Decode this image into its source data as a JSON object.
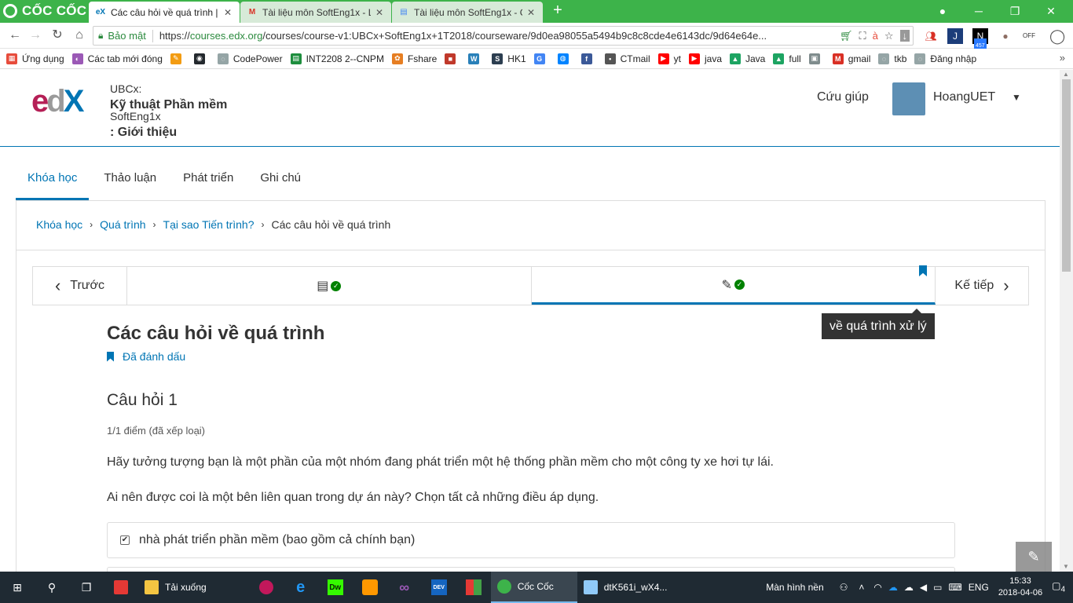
{
  "browser": {
    "brand": "CỐC CỐC",
    "tabs": [
      {
        "label": "Các câu hỏi về quá trình | ",
        "icon": "edx"
      },
      {
        "label": "Tài liệu môn SoftEng1x - L",
        "icon": "gmail"
      },
      {
        "label": "Tài liệu môn SoftEng1x - G",
        "icon": "docs"
      }
    ],
    "new_tab": "+",
    "secure_label": "Bảo mật",
    "url_scheme": "https://",
    "url_host": "courses.edx.org",
    "url_path": "/courses/course-v1:UBCx+SoftEng1x+1T2018/courseware/9d0ea98055a5494b9c8c8cde4e6143dc/9d64e64e...",
    "ext_badges": {
      "first": "1",
      "second": "457"
    }
  },
  "bookmarks": [
    {
      "label": "Ứng dụng",
      "color": "#e74c3c",
      "glyph": "▦"
    },
    {
      "label": "Các tab mới đóng",
      "color": "#9b59b6",
      "glyph": "◐"
    },
    {
      "label": "",
      "color": "#f39c12",
      "glyph": "✎"
    },
    {
      "label": "",
      "color": "#24292e",
      "glyph": "◉"
    },
    {
      "label": "CodePower",
      "color": "#95a5a6",
      "glyph": "◌"
    },
    {
      "label": "INT2208 2--CNPM",
      "color": "#1e8e3e",
      "glyph": "▤"
    },
    {
      "label": "Fshare",
      "color": "#e67e22",
      "glyph": "✿"
    },
    {
      "label": "",
      "color": "#c0392b",
      "glyph": "■"
    },
    {
      "label": "",
      "color": "#2980b9",
      "glyph": "W"
    },
    {
      "label": "HK1",
      "color": "#2c3e50",
      "glyph": "S"
    },
    {
      "label": "",
      "color": "#4285f4",
      "glyph": "G"
    },
    {
      "label": "",
      "color": "#0084ff",
      "glyph": "◍"
    },
    {
      "label": "",
      "color": "#3b5998",
      "glyph": "f"
    },
    {
      "label": "CTmail",
      "color": "#555555",
      "glyph": "•"
    },
    {
      "label": "yt",
      "color": "#ff0000",
      "glyph": "▶"
    },
    {
      "label": "java",
      "color": "#ff0000",
      "glyph": "▶"
    },
    {
      "label": "Java",
      "color": "#1da462",
      "glyph": "▲"
    },
    {
      "label": "full",
      "color": "#1da462",
      "glyph": "▲"
    },
    {
      "label": "",
      "color": "#7f8c8d",
      "glyph": "▣"
    },
    {
      "label": "gmail",
      "color": "#d93025",
      "glyph": "M"
    },
    {
      "label": "tkb",
      "color": "#95a5a6",
      "glyph": "◌"
    },
    {
      "label": "Đăng nhập",
      "color": "#95a5a6",
      "glyph": "◌"
    }
  ],
  "bookmarks_more": "»",
  "header": {
    "org": "UBCx:",
    "course_name": "Kỹ thuật Phần mềm",
    "course_code": "SoftEng1x",
    "course_sub": ": Giới thiệu",
    "help": "Cứu giúp",
    "username": "HoangUET",
    "user_caret": "▼"
  },
  "course_tabs": [
    {
      "label": "Khóa học",
      "active": true
    },
    {
      "label": "Thảo luận",
      "active": false
    },
    {
      "label": "Phát triển",
      "active": false
    },
    {
      "label": "Ghi chú",
      "active": false
    }
  ],
  "breadcrumb": {
    "items": [
      "Khóa học",
      "Quá trình",
      "Tại sao Tiến trình?"
    ],
    "current": "Các câu hỏi về quá trình",
    "separator": "›"
  },
  "sequence": {
    "prev": "Trước",
    "next": "Kế tiếp",
    "prev_icon": "‹",
    "next_icon": "›",
    "check_glyph": "✓",
    "video_icon": "▤",
    "problem_icon": "✎"
  },
  "tooltip": "về quá trình xử lý",
  "unit": {
    "title": "Các câu hỏi về quá trình",
    "bookmarked": "Đã đánh dấu"
  },
  "question": {
    "title": "Câu hỏi 1",
    "score": "1/1 điểm (đã xếp loại)",
    "p1": "Hãy tưởng tượng bạn là một phần của một nhóm đang phát triển một hệ thống phần mềm cho một công ty xe hơi tự lái.",
    "p2": "Ai nên được coi là một bên liên quan trong dự án này? Chọn tất cả những điều áp dụng.",
    "choice1": "nhà phát triển phần mềm (bao gồm cả chính bạn)",
    "choice1_mark": "✔"
  },
  "edit_icon": "✎",
  "taskbar": {
    "downloads": "Tải xuống",
    "coccoc": "Cốc Cốc",
    "file": "dtK561i_wX4...",
    "desktop": "Màn hình nền",
    "lang": "ENG",
    "time": "15:33",
    "date": "2018-04-06",
    "notif": "4"
  },
  "colors": {
    "accent": "#0075b4",
    "success": "#008100",
    "browser_green": "#3db34a"
  }
}
